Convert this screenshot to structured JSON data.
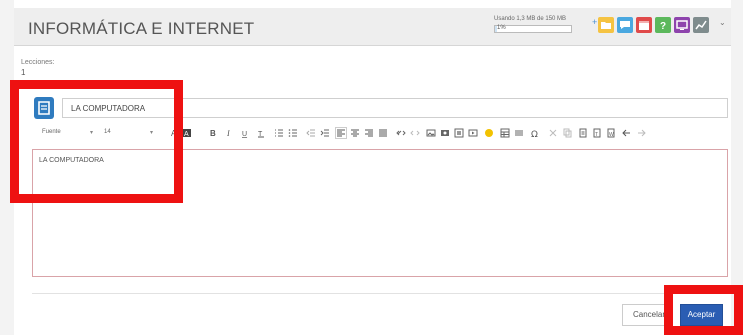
{
  "header": {
    "title": "INFORMÁTICA E INTERNET",
    "quota_text": "Usando 1,3 MB de 150 MB",
    "quota_percent_label": "1%",
    "quota_fraction": 0.01,
    "add_label": "+",
    "buttons": [
      {
        "icon": "folder-icon",
        "color": "#f5c342"
      },
      {
        "icon": "chat-icon",
        "color": "#4aa8e0"
      },
      {
        "icon": "calendar-icon",
        "color": "#e04a4a"
      },
      {
        "icon": "help-icon",
        "color": "#5cb85c"
      },
      {
        "icon": "screen-icon",
        "color": "#8e44ad"
      },
      {
        "icon": "chart-icon",
        "color": "#7f8c8d"
      }
    ],
    "caret": "⌄"
  },
  "lessons": {
    "label": "Lecciones:",
    "count": "1"
  },
  "lesson_title": "LA COMPUTADORA",
  "toolbar": {
    "font_label": "Fuente",
    "size_label": "14",
    "font_arrow": "▾",
    "size_arrow": "▾"
  },
  "editor": {
    "content": "LA COMPUTADORA"
  },
  "footer": {
    "cancel_label": "Cancelar",
    "accept_label": "Aceptar"
  },
  "colors": {
    "highlight": "#ee1111",
    "accept": "#2a5db3"
  }
}
